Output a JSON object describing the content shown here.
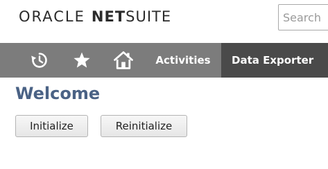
{
  "header": {
    "logo": {
      "oracle": "ORACLE",
      "net": "NET",
      "suite": "SUITE"
    },
    "search": {
      "placeholder": "Search",
      "value": ""
    }
  },
  "navbar": {
    "icons": [
      "history-icon",
      "star-icon",
      "home-icon"
    ],
    "tabs": [
      {
        "label": "Activities",
        "active": false
      },
      {
        "label": "Data Exporter",
        "active": true
      }
    ]
  },
  "main": {
    "title": "Welcome",
    "buttons": {
      "initialize": "Initialize",
      "reinitialize": "Reinitialize"
    }
  },
  "colors": {
    "navbar_bg": "#7c7c7c",
    "navbar_active_bg": "#4a4a4a",
    "title_color": "#4a6285"
  }
}
